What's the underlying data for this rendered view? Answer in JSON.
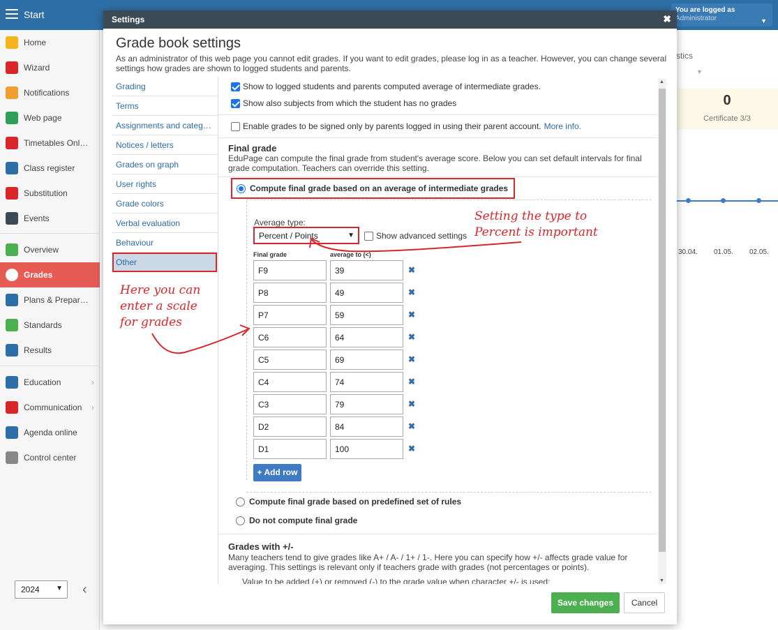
{
  "topbar": {
    "app_title": "Start",
    "logged_line1": "You are logged as",
    "logged_line2": "Administrator"
  },
  "sidebar": {
    "items": [
      {
        "label": "Home",
        "icon": "star-icon"
      },
      {
        "label": "Wizard",
        "icon": "wand-icon"
      },
      {
        "label": "Notifications",
        "icon": "envelope-icon"
      },
      {
        "label": "Web page",
        "icon": "house-icon"
      },
      {
        "label": "Timetables Onl…",
        "icon": "calendar-grid-icon"
      },
      {
        "label": "Class register",
        "icon": "register-book-icon"
      },
      {
        "label": "Substitution",
        "icon": "person-icon"
      },
      {
        "label": "Events",
        "icon": "event-calendar-icon"
      },
      {
        "label": "Overview",
        "icon": "check-circle-icon"
      },
      {
        "label": "Grades",
        "icon": "grade-a-plus-icon"
      },
      {
        "label": "Plans & Prepar…",
        "icon": "briefcase-icon"
      },
      {
        "label": "Standards",
        "icon": "shield-check-icon"
      },
      {
        "label": "Results",
        "icon": "bar-chart-icon"
      },
      {
        "label": "Education",
        "icon": "book-icon"
      },
      {
        "label": "Communication",
        "icon": "chat-bubbles-icon"
      },
      {
        "label": "Agenda online",
        "icon": "pen-icon"
      },
      {
        "label": "Control center",
        "icon": "gear-icon"
      }
    ],
    "year": "2024"
  },
  "background": {
    "tab_fragment": "stics",
    "stat_number": "0",
    "stat_caption": "Certificate 3/3",
    "dates": [
      "30.04.",
      "01.05.",
      "02.05."
    ]
  },
  "modal": {
    "header": "Settings",
    "title": "Grade book settings",
    "description": "As an administrator of this web page you cannot edit grades. If you want to edit grades, please log in as a teacher. However, you can change several settings how grades are shown to logged students and parents.",
    "tabs": [
      "Grading",
      "Terms",
      "Assignments and categ…",
      "Notices / letters",
      "Grades on graph",
      "User rights",
      "Grade colors",
      "Verbal evaluation",
      "Behaviour",
      "Other"
    ],
    "selected_tab": "Other",
    "checkboxes": {
      "show_average": "Show to logged students and parents computed average of intermediate grades.",
      "show_subjects": "Show also subjects from which the student has no grades",
      "sign_by_parents": "Enable grades to be signed only by parents logged in using their parent account.",
      "more_info": "More info."
    },
    "final_grade": {
      "title": "Final grade",
      "description": "EduPage can compute the final grade from student's average score. Below you can set default intervals for final grade computation. Teachers can override this setting.",
      "option_average": "Compute final grade based on an average of intermediate grades",
      "option_rules": "Compute final grade based on predefined set of rules",
      "option_none": "Do not compute final grade",
      "average_type_label": "Average type:",
      "average_type_value": "Percent / Points",
      "show_advanced": "Show advanced settings",
      "col_final": "Final grade",
      "col_average": "average to (<)",
      "rows": [
        {
          "grade": "F9",
          "avg": "39"
        },
        {
          "grade": "P8",
          "avg": "49"
        },
        {
          "grade": "P7",
          "avg": "59"
        },
        {
          "grade": "C6",
          "avg": "64"
        },
        {
          "grade": "C5",
          "avg": "69"
        },
        {
          "grade": "C4",
          "avg": "74"
        },
        {
          "grade": "C3",
          "avg": "79"
        },
        {
          "grade": "D2",
          "avg": "84"
        },
        {
          "grade": "D1",
          "avg": "100"
        }
      ],
      "add_row": "+ Add row"
    },
    "plus_minus": {
      "title": "Grades with +/-",
      "description": "Many teachers tend to give grades like A+ / A- / 1+ / 1-. Here you can specify how +/- affects grade value for averaging. This settings is relevant only if teachers grade with grades (not percentages or points).",
      "value_label": "Value to be added (+) or removed (-) to the grade value when character +/- is used:"
    },
    "save": "Save changes",
    "cancel": "Cancel"
  },
  "annotations": {
    "scale_note": "Here you can\nenter a scale\nfor grades",
    "type_note": "Setting the type to\nPercent is important",
    "color": "#d9262b"
  }
}
